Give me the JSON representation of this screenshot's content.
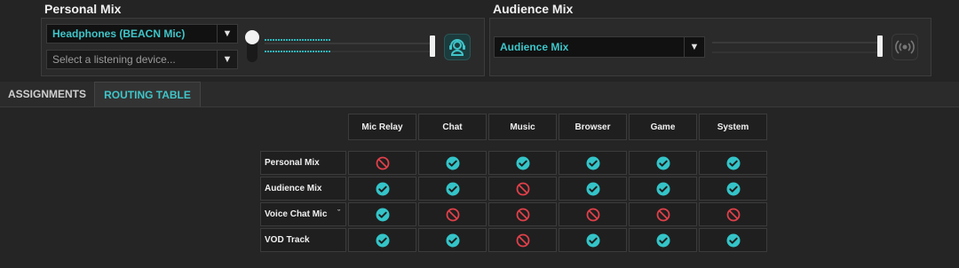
{
  "personal_mix": {
    "title": "Personal Mix",
    "device_select": "Headphones (BEACN Mic)",
    "listening_placeholder": "Select a listening device...",
    "dropdown_arrow": "▼",
    "volume_level": 1.0,
    "icon": "headset-icon"
  },
  "audience_mix": {
    "title": "Audience Mix",
    "select": "Audience Mix",
    "dropdown_arrow": "▼",
    "volume_level": 1.0,
    "icon": "broadcast-icon"
  },
  "tabs": [
    {
      "label": "ASSIGNMENTS",
      "active": false
    },
    {
      "label": "ROUTING TABLE",
      "active": true
    }
  ],
  "routing_table": {
    "columns": [
      "Mic Relay",
      "Chat",
      "Music",
      "Browser",
      "Game",
      "System"
    ],
    "rows": [
      {
        "label": "Personal Mix",
        "values": [
          false,
          true,
          true,
          true,
          true,
          true
        ]
      },
      {
        "label": "Audience Mix",
        "values": [
          true,
          true,
          false,
          true,
          true,
          true
        ]
      },
      {
        "label": "Voice Chat Mic",
        "values": [
          true,
          false,
          false,
          false,
          false,
          false
        ],
        "has_dropdown": true
      },
      {
        "label": "VOD Track",
        "values": [
          true,
          true,
          false,
          true,
          true,
          true
        ]
      }
    ],
    "row_dropdown_glyph": "ˇ"
  },
  "colors": {
    "accent": "#3fc5c9",
    "check": "#34c4c8",
    "blocked": "#e0404a",
    "background": "#242424"
  }
}
